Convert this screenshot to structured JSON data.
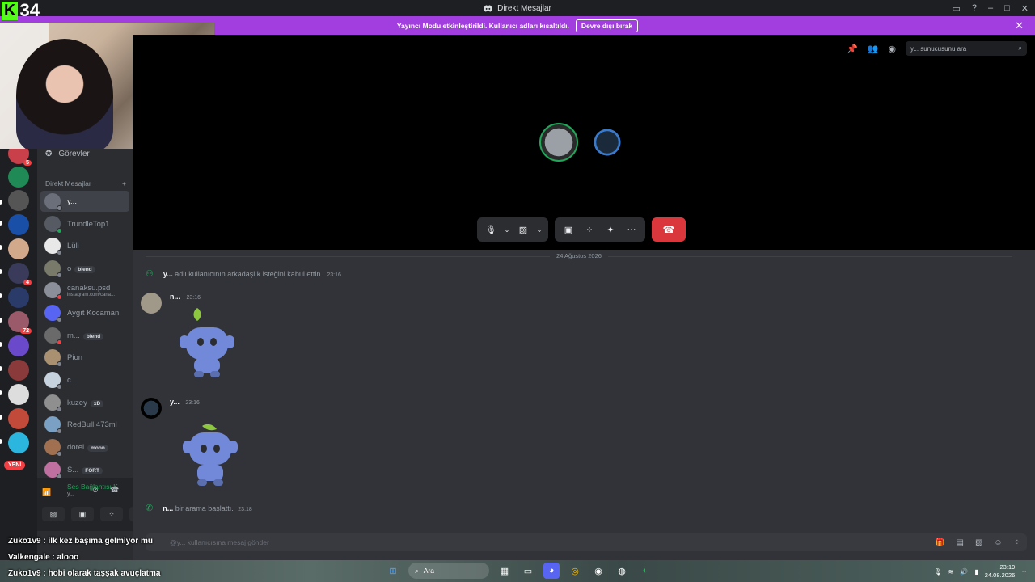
{
  "window": {
    "title": "Direkt Mesajlar"
  },
  "banner": {
    "text": "Yayıncı Modu etkinleştirildi. Kullanıcı adları kısaltıldı.",
    "button": "Devre dışı bırak"
  },
  "stream_overlay": {
    "logo_text": "34",
    "chat": [
      {
        "user": "Zuko1v9",
        "text": "ilk kez başıma gelmiyor mu"
      },
      {
        "user": "Valkengale",
        "text": "alooo"
      },
      {
        "user": "Zuko1v9",
        "text": "hobi olarak taşşak avuçlatma"
      }
    ]
  },
  "servers": {
    "badges": [
      "5",
      "4",
      "72"
    ],
    "new_label": "YENİ"
  },
  "sidebar": {
    "quests_label": "Görevler",
    "dm_header": "Direkt Mesajlar",
    "add_icon": "plus-icon",
    "dms": [
      {
        "name": "y...",
        "status": "#80848e",
        "active": true,
        "color": "#6b6f7a"
      },
      {
        "name": "TrundleTop1",
        "status": "#23a55a",
        "color": "#555a63"
      },
      {
        "name": "Lüli",
        "status": "#80848e",
        "color": "#e8e8e8"
      },
      {
        "name": "o",
        "tag": "blend",
        "status": "#80848e",
        "color": "#7a7a6a"
      },
      {
        "name": "canaksu.psd",
        "sub": "instagram.com/cana...",
        "status": "#f23f43",
        "color": "#8a8f99"
      },
      {
        "name": "Aygıt Kocaman",
        "status": "#80848e",
        "color": "#5865f2"
      },
      {
        "name": "m...",
        "tag": "blend",
        "status": "#f23f43",
        "color": "#6a6a6a"
      },
      {
        "name": "Pion",
        "status": "#80848e",
        "color": "#a89070"
      },
      {
        "name": "c...",
        "status": "#80848e",
        "color": "#c6d2dd"
      },
      {
        "name": "kuzey",
        "tag": "xD",
        "status": "#80848e",
        "color": "#8f8f8f"
      },
      {
        "name": "RedBull 473ml",
        "status": "#80848e",
        "color": "#7aa0c4"
      },
      {
        "name": "dorel",
        "tag": "moon",
        "status": "#80848e",
        "color": "#a07050"
      },
      {
        "name": "S...",
        "tag": "FORT",
        "status": "#80848e",
        "color": "#c070a0"
      }
    ],
    "voice": {
      "status": "Ses Bağlantısı K",
      "sub": "y..."
    }
  },
  "call": {
    "search_placeholder": "y... sunucusunu ara"
  },
  "chat": {
    "date": "24 Ağustos 2026",
    "system_friend": {
      "user": "y...",
      "text": "adlı kullanıcının arkadaşlık isteğini kabul ettin.",
      "time": "23:16"
    },
    "messages": [
      {
        "user": "n...",
        "time": "23:16"
      },
      {
        "user": "y...",
        "time": "23:16"
      }
    ],
    "system_call": {
      "user": "n...",
      "text": "bir arama başlattı.",
      "time": "23:18"
    },
    "composer_placeholder": "@y... kullanıcısına mesaj gönder"
  },
  "taskbar": {
    "search": "Ara",
    "time": "23:19",
    "date": "24.08.2026"
  },
  "colors": {
    "brand": "#5865f2",
    "banner": "#a23de0",
    "hangup": "#da373c",
    "online": "#23a55a"
  }
}
